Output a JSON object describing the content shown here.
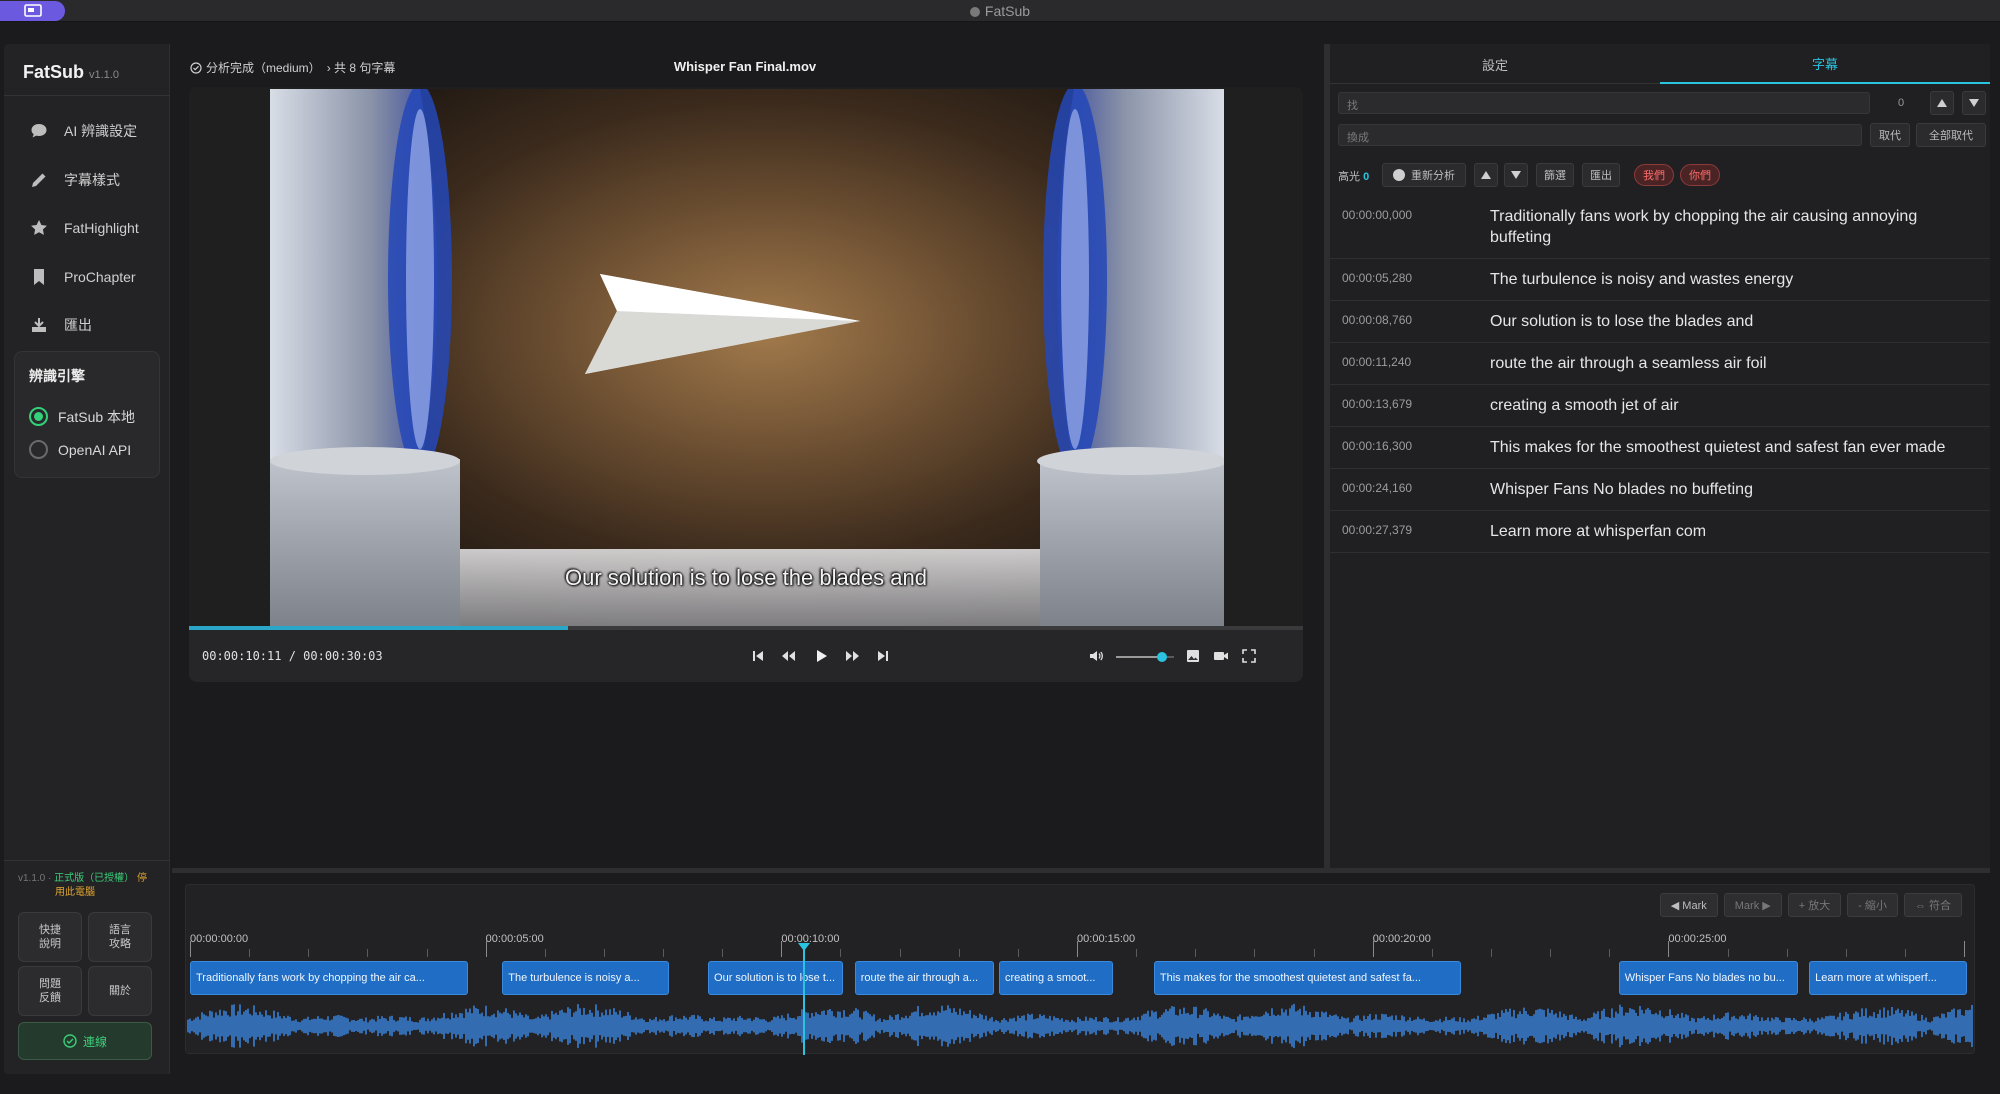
{
  "app": {
    "window_title": "FatSub",
    "name": "FatSub",
    "version": "v1.1.0"
  },
  "sidebar": {
    "items": [
      {
        "label": "AI 辨識設定",
        "icon": "chat-bubble-icon"
      },
      {
        "label": "字幕樣式",
        "icon": "pen-icon"
      },
      {
        "label": "FatHighlight",
        "icon": "star-icon"
      },
      {
        "label": "ProChapter",
        "icon": "bookmark-icon"
      },
      {
        "label": "匯出",
        "icon": "export-icon"
      }
    ],
    "engine": {
      "title": "辨識引擎",
      "options": [
        {
          "label": "FatSub 本地",
          "selected": true
        },
        {
          "label": "OpenAI API",
          "selected": false
        }
      ]
    },
    "license": {
      "version": "v1.1.0",
      "sep": "·",
      "status": "正式版（已授權）",
      "action1": "停",
      "action2": "用此電腦"
    },
    "buttons": {
      "shortcuts": "快捷 說明",
      "language": "語言 攻略",
      "feedback": "問題 反饋",
      "about": "關於"
    },
    "connect_label": "連線"
  },
  "header": {
    "status": "分析完成（medium）",
    "count": "› 共 8 句字幕",
    "file_title": "Whisper Fan Final.mov"
  },
  "player": {
    "subtitle_overlay": "Our solution is to lose the blades and",
    "timecode": "00:00:10:11 / 00:00:30:03",
    "progress": 0.34,
    "volume": 0.8
  },
  "right_panel": {
    "tabs": [
      {
        "label": "設定",
        "active": false
      },
      {
        "label": "字幕",
        "active": true
      }
    ],
    "find_placeholder": "找",
    "replace_placeholder": "換成",
    "match_count": "0",
    "replace_label": "取代",
    "replace_all_label": "全部取代",
    "highlight_label": "高光",
    "highlight_count": "0",
    "reanalyze_label": "重新分析",
    "filter_label": "篩選",
    "export_label": "匯出",
    "tags": [
      "我們",
      "你們"
    ],
    "subtitles": [
      {
        "time": "00:00:00,000",
        "text": "Traditionally fans work by chopping the air causing annoying buffeting"
      },
      {
        "time": "00:00:05,280",
        "text": "The turbulence is noisy and wastes energy"
      },
      {
        "time": "00:00:08,760",
        "text": "Our solution is to lose the blades and"
      },
      {
        "time": "00:00:11,240",
        "text": "route the air through a seamless air foil"
      },
      {
        "time": "00:00:13,679",
        "text": "creating a smooth jet of air"
      },
      {
        "time": "00:00:16,300",
        "text": "This makes for the smoothest quietest and safest fan ever made"
      },
      {
        "time": "00:00:24,160",
        "text": "Whisper Fans No blades no buffeting"
      },
      {
        "time": "00:00:27,379",
        "text": "Learn more at whisperfan com"
      }
    ]
  },
  "timeline": {
    "buttons": {
      "mark_prev": "◀ Mark",
      "mark_next": "Mark ▶",
      "zoom_in": "+ 放大",
      "zoom_out": "- 縮小",
      "fit": "⇔ 符合"
    },
    "ticks": [
      "00:00:00:00",
      "00:00:05:00",
      "00:00:10:00",
      "00:00:15:00",
      "00:00:20:00",
      "00:00:25:00"
    ],
    "clips": [
      "Traditionally fans work by chopping the air ca...",
      "The turbulence is noisy a...",
      "Our solution is to lose t...",
      "route the air through a...",
      "creating a smoot...",
      "This makes for the smoothest quietest and safest fa...",
      "Whisper Fans No blades no bu...",
      "Learn more at whisperf..."
    ],
    "clip_times": [
      [
        0,
        4.7
      ],
      [
        5.28,
        8.1
      ],
      [
        8.76,
        11.05
      ],
      [
        11.24,
        13.6
      ],
      [
        13.68,
        15.6
      ],
      [
        16.3,
        21.5
      ],
      [
        24.16,
        27.2
      ],
      [
        27.38,
        30.05
      ]
    ],
    "playhead_seconds": 10.37,
    "duration_seconds": 30.1
  },
  "colors": {
    "accent": "#2ac3e0",
    "clip": "#1f6dc4",
    "success": "#33d17a",
    "tag": "#ff6b6b"
  }
}
